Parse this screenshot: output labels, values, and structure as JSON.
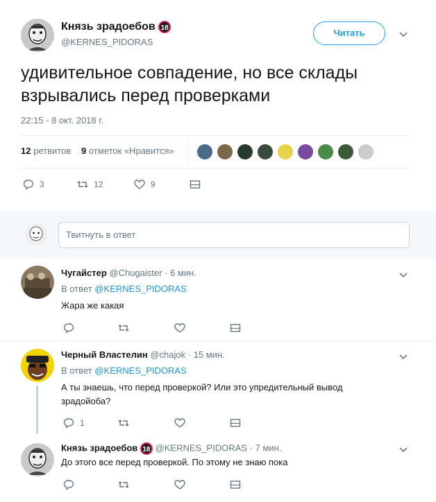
{
  "tweet": {
    "author_name": "Князь зрадоебов",
    "author_badge": "18",
    "handle": "@KERNES_PIDORAS",
    "follow_label": "Читать",
    "text": "удивительное совпадение, но все склады взрывались перед проверками",
    "timestamp": "22:15 - 8 окт. 2018 г.",
    "retweets_count": "12",
    "retweets_label": "ретвитов",
    "likes_count": "9",
    "likes_label": "отметок «Нравится»",
    "actions": {
      "replies": "3",
      "retweets": "12",
      "likes": "9"
    },
    "liker_avatar_colors": [
      "#4a6a8a",
      "#7a6a4a",
      "#2a3a2a",
      "#3a4a3a",
      "#e8d24a",
      "#7a4aa0",
      "#4a8a4a",
      "#3a5a3a",
      "#cccccc"
    ]
  },
  "reply_box": {
    "placeholder": "Твитнуть в ответ"
  },
  "replies": [
    {
      "name": "Чугайстер",
      "handle": "@Chugaister",
      "time": "· 6 мин.",
      "reply_to_prefix": "В ответ",
      "reply_to": "@KERNES_PIDORAS",
      "text": "Жара же какая",
      "reply_count": "",
      "retweet_count": "",
      "like_count": ""
    },
    {
      "name": "Черный Властелин",
      "handle": "@chajok",
      "time": "· 15 мин.",
      "reply_to_prefix": "В ответ",
      "reply_to": "@KERNES_PIDORAS",
      "text": "А ты знаешь, что перед проверкой? Или это  упредительный вывод зрадойоба?",
      "reply_count": "1",
      "retweet_count": "",
      "like_count": ""
    },
    {
      "name": "Князь зрадоебов",
      "badge": "18",
      "handle": "@KERNES_PIDORAS",
      "time": "· 7 мин.",
      "text": "До этого все перед проверкой. По этому не знаю пока",
      "reply_count": "",
      "retweet_count": "",
      "like_count": ""
    }
  ],
  "colors": {
    "accent": "#1da1f2",
    "link": "#1b95e0",
    "muted": "#657786",
    "badge_ring": "#e0245e"
  }
}
